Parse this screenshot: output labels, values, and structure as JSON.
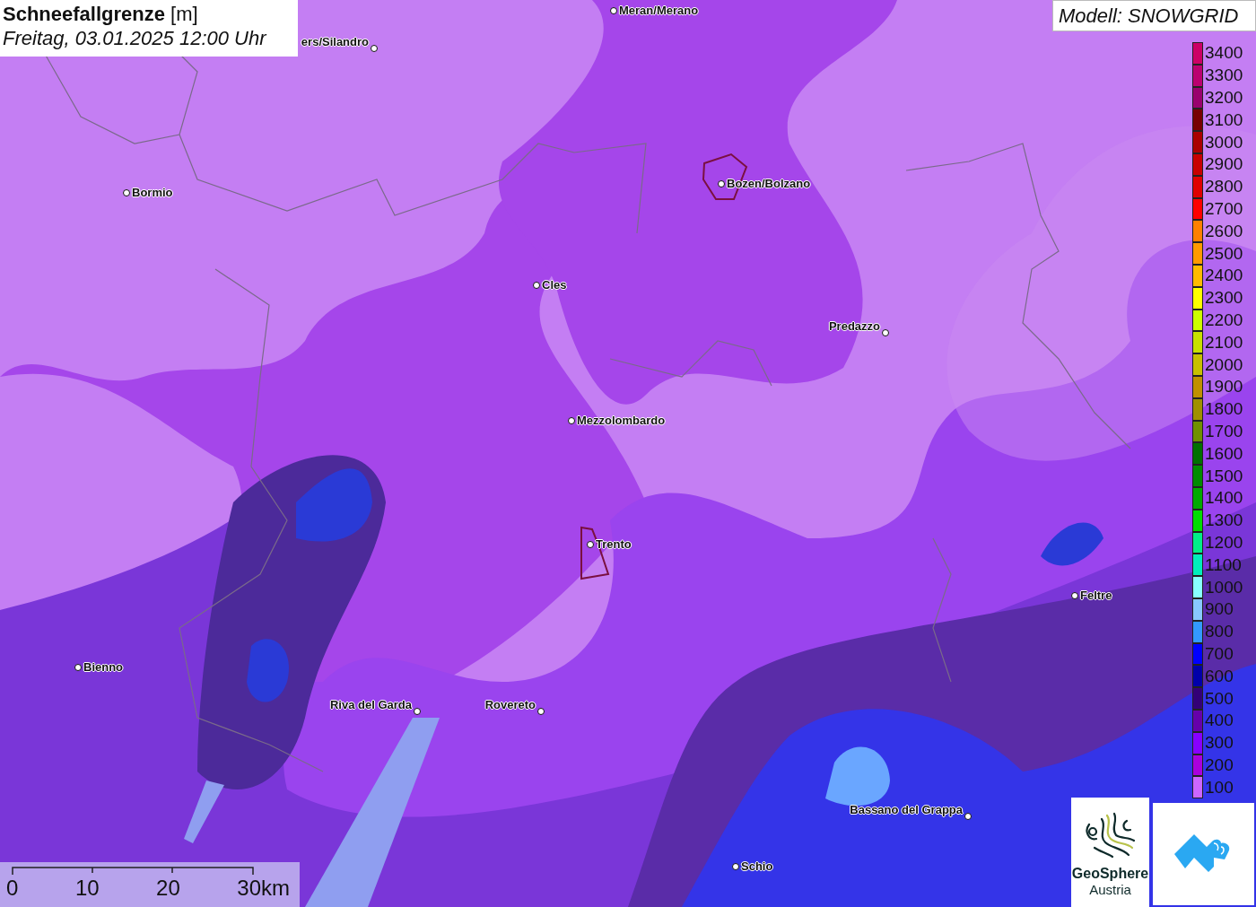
{
  "title": {
    "text": "**Schneefallgrenze** [m]",
    "datetime": "Freitag, 03.01.2025 12:00 Uhr"
  },
  "model": "Modell: SNOWGRID",
  "cities": [
    {
      "name": "Meran/Merano"
    },
    {
      "name": "ers/Silandro"
    },
    {
      "name": "Bormio"
    },
    {
      "name": "Bozen/Bolzano"
    },
    {
      "name": "Cles"
    },
    {
      "name": "Predazzo"
    },
    {
      "name": "Mezzolombardo"
    },
    {
      "name": "Trento"
    },
    {
      "name": "Feltre"
    },
    {
      "name": "Bienno"
    },
    {
      "name": "Riva del Garda"
    },
    {
      "name": "Rovereto"
    },
    {
      "name": "Bassano del Grappa"
    },
    {
      "name": "Schio"
    }
  ],
  "legend": [
    {
      "label": "3400",
      "color": "#cc0066"
    },
    {
      "label": "3300",
      "color": "#bb0070"
    },
    {
      "label": "3200",
      "color": "#99006e"
    },
    {
      "label": "3100",
      "color": "#770000"
    },
    {
      "label": "3000",
      "color": "#aa0000"
    },
    {
      "label": "2900",
      "color": "#c80000"
    },
    {
      "label": "2800",
      "color": "#e00000"
    },
    {
      "label": "2700",
      "color": "#ff0000"
    },
    {
      "label": "2600",
      "color": "#ff8000"
    },
    {
      "label": "2500",
      "color": "#ff9a00"
    },
    {
      "label": "2400",
      "color": "#ffbb00"
    },
    {
      "label": "2300",
      "color": "#ffff00"
    },
    {
      "label": "2200",
      "color": "#ccff00"
    },
    {
      "label": "2100",
      "color": "#c8e000"
    },
    {
      "label": "2000",
      "color": "#c8c000"
    },
    {
      "label": "1900",
      "color": "#c09000"
    },
    {
      "label": "1800",
      "color": "#a09000"
    },
    {
      "label": "1700",
      "color": "#709000"
    },
    {
      "label": "1600",
      "color": "#007000"
    },
    {
      "label": "1500",
      "color": "#008c00"
    },
    {
      "label": "1400",
      "color": "#00aa00"
    },
    {
      "label": "1300",
      "color": "#00dd00"
    },
    {
      "label": "1200",
      "color": "#00ee88"
    },
    {
      "label": "1100",
      "color": "#00eebb"
    },
    {
      "label": "1000",
      "color": "#88ffff"
    },
    {
      "label": "900",
      "color": "#88c8ff"
    },
    {
      "label": "800",
      "color": "#3399ff"
    },
    {
      "label": "700",
      "color": "#0000ff"
    },
    {
      "label": "600",
      "color": "#0000aa"
    },
    {
      "label": "500",
      "color": "#330077"
    },
    {
      "label": "400",
      "color": "#6600aa"
    },
    {
      "label": "300",
      "color": "#8800ff"
    },
    {
      "label": "200",
      "color": "#aa00dd"
    },
    {
      "label": "100",
      "color": "#cc66ff"
    }
  ],
  "scale_bar": {
    "ticks": [
      "0",
      "10",
      "20",
      "30km"
    ]
  },
  "logos": [
    {
      "kind": "geosphere",
      "lines": [
        "GeoSphere",
        "Austria"
      ]
    },
    {
      "kind": "app"
    }
  ]
}
